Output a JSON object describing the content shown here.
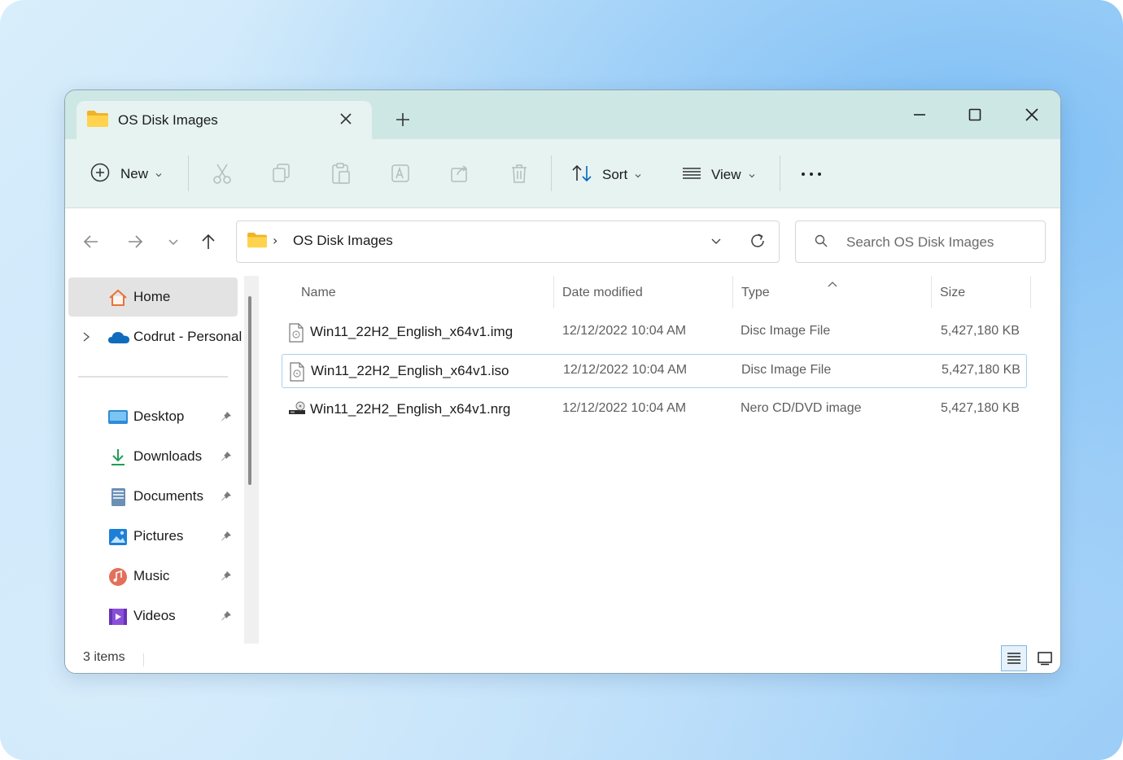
{
  "window": {
    "tab_title": "OS Disk Images"
  },
  "toolbar": {
    "new_label": "New",
    "sort_label": "Sort",
    "view_label": "View",
    "more_label": "···"
  },
  "address": {
    "crumb_separator": "›",
    "current_folder": "OS Disk Images"
  },
  "search": {
    "placeholder": "Search OS Disk Images"
  },
  "sidebar": {
    "items": [
      {
        "label": "Home",
        "icon": "home-icon"
      },
      {
        "label": "Codrut - Personal",
        "icon": "onedrive-icon"
      },
      {
        "label": "Desktop",
        "icon": "desktop-icon"
      },
      {
        "label": "Downloads",
        "icon": "downloads-icon"
      },
      {
        "label": "Documents",
        "icon": "documents-icon"
      },
      {
        "label": "Pictures",
        "icon": "pictures-icon"
      },
      {
        "label": "Music",
        "icon": "music-icon"
      },
      {
        "label": "Videos",
        "icon": "videos-icon"
      }
    ]
  },
  "columns": {
    "name": "Name",
    "date": "Date modified",
    "type": "Type",
    "size": "Size"
  },
  "files": [
    {
      "name": "Win11_22H2_English_x64v1.img",
      "date": "12/12/2022 10:04 AM",
      "type": "Disc Image File",
      "size": "5,427,180 KB",
      "icon": "disc-image-icon"
    },
    {
      "name": "Win11_22H2_English_x64v1.iso",
      "date": "12/12/2022 10:04 AM",
      "type": "Disc Image File",
      "size": "5,427,180 KB",
      "icon": "disc-image-icon"
    },
    {
      "name": "Win11_22H2_English_x64v1.nrg",
      "date": "12/12/2022 10:04 AM",
      "type": "Nero CD/DVD image",
      "size": "5,427,180 KB",
      "icon": "nero-drive-icon"
    }
  ],
  "status": {
    "items_count": "3 items"
  },
  "colors": {
    "titlebar": "#cde7e4",
    "toolbar": "#e6f3f1",
    "selection_border": "#a8d0ee",
    "accent": "#0067c0"
  }
}
